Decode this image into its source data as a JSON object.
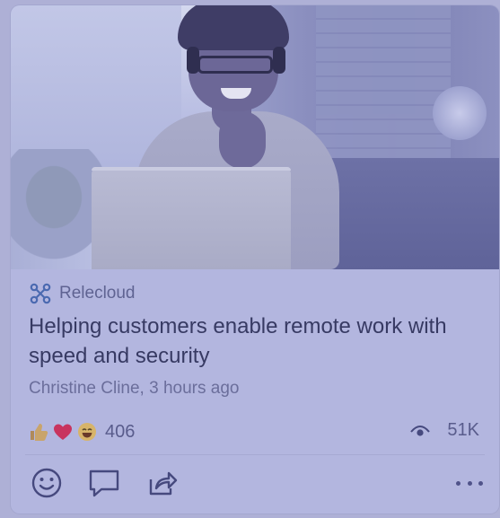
{
  "card": {
    "image": {
      "alt_icon": "hero-photo"
    },
    "source": {
      "icon": "relecloud-logo-icon",
      "name": "Relecloud"
    },
    "headline": "Helping customers enable remote work with speed and security",
    "byline": "Christine Cline, 3 hours ago",
    "reactions": {
      "icons": [
        "thumbs-up-icon",
        "heart-icon",
        "laugh-icon"
      ],
      "count": "406"
    },
    "views": {
      "icon": "eye-icon",
      "count": "51K"
    },
    "actions": [
      "smiley-icon",
      "comment-icon",
      "share-icon",
      "more-icon"
    ]
  },
  "colors": {
    "overlay": "#b3b6df",
    "text_primary": "#373a63",
    "text_secondary": "#6b6e9b",
    "heart": "#c8345f",
    "icon_stroke": "#46497e"
  }
}
